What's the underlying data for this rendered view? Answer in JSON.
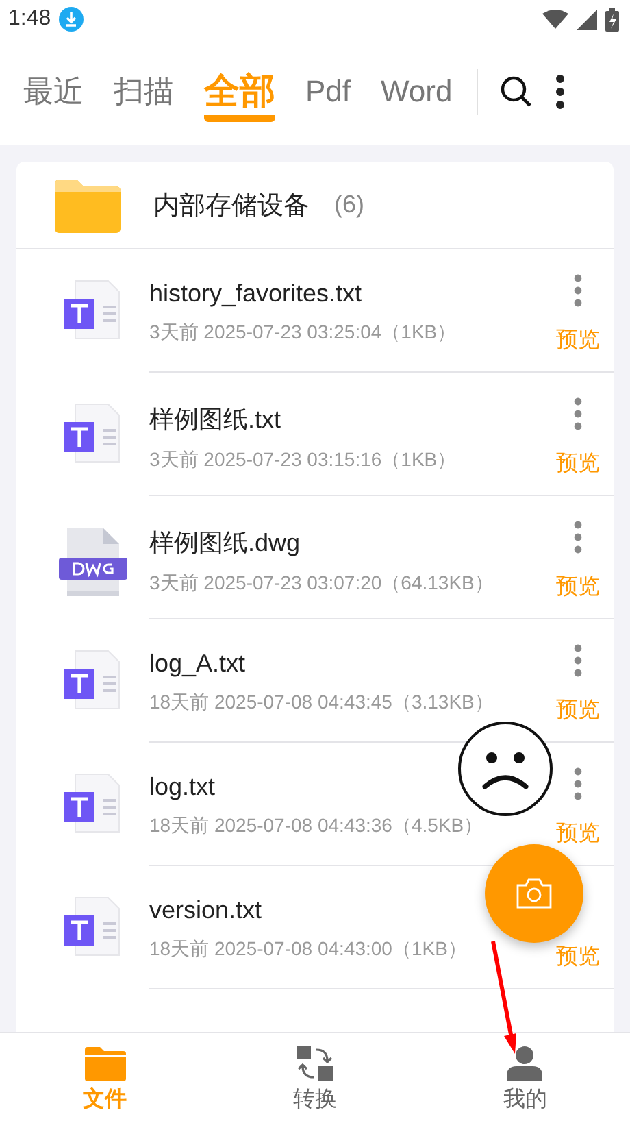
{
  "status_bar": {
    "time": "1:48"
  },
  "tabs": [
    {
      "label": "最近",
      "selected": false
    },
    {
      "label": "扫描",
      "selected": false
    },
    {
      "label": "全部",
      "selected": true
    },
    {
      "label": "Pdf",
      "selected": false
    },
    {
      "label": "Word",
      "selected": false
    }
  ],
  "folder": {
    "name": "内部存储设备",
    "count": "(6)"
  },
  "files": [
    {
      "kind": "txt",
      "name": "history_favorites.txt",
      "meta": "3天前 2025-07-23 03:25:04（1KB）",
      "action": "预览"
    },
    {
      "kind": "txt",
      "name": "样例图纸.txt",
      "meta": "3天前 2025-07-23 03:15:16（1KB）",
      "action": "预览"
    },
    {
      "kind": "dwg",
      "name": "样例图纸.dwg",
      "meta": "3天前 2025-07-23 03:07:20（64.13KB）",
      "action": "预览"
    },
    {
      "kind": "txt",
      "name": "log_A.txt",
      "meta": "18天前 2025-07-08 04:43:45（3.13KB）",
      "action": "预览"
    },
    {
      "kind": "txt",
      "name": "log.txt",
      "meta": "18天前 2025-07-08 04:43:36（4.5KB）",
      "action": "预览"
    },
    {
      "kind": "txt",
      "name": "version.txt",
      "meta": "18天前 2025-07-08 04:43:00（1KB）",
      "action": "预览",
      "menu": false
    }
  ],
  "bottom_nav": [
    {
      "label": "文件",
      "selected": true
    },
    {
      "label": "转换",
      "selected": false
    },
    {
      "label": "我的",
      "selected": false
    }
  ]
}
